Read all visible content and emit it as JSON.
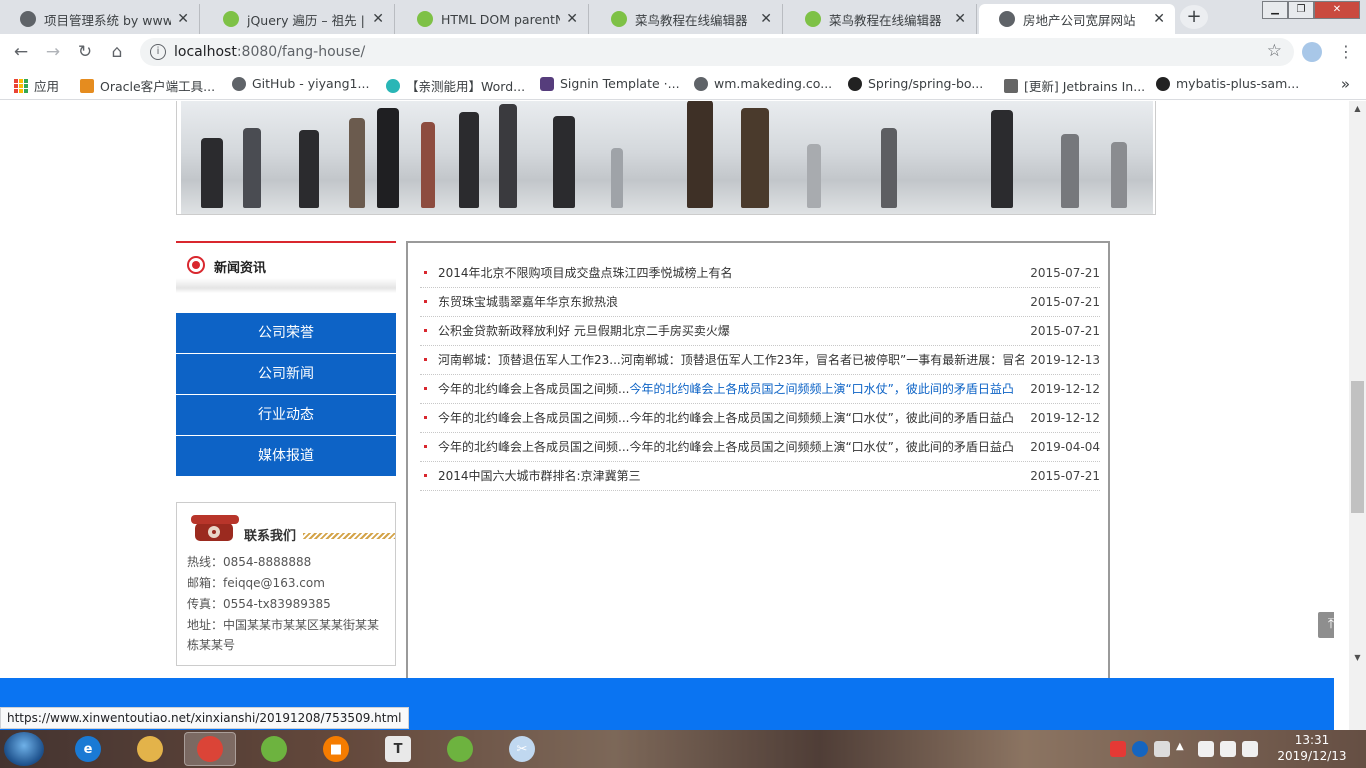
{
  "browser": {
    "tabs": [
      {
        "title": "项目管理系统 by www.n",
        "icon": "globe-icon",
        "active": false
      },
      {
        "title": "jQuery 遍历 – 祖先 | 菜鸟",
        "icon": "runoob-icon",
        "active": false
      },
      {
        "title": "HTML DOM parentNode",
        "icon": "runoob-icon",
        "active": false
      },
      {
        "title": "菜鸟教程在线编辑器",
        "icon": "runoob-icon",
        "active": false
      },
      {
        "title": "菜鸟教程在线编辑器",
        "icon": "runoob-icon",
        "active": false
      },
      {
        "title": "房地产公司宽屏网站",
        "icon": "globe-icon",
        "active": true
      }
    ],
    "address": {
      "host": "localhost",
      "rest": ":8080/fang-house/"
    },
    "bookmarks": [
      {
        "label": "应用",
        "icon": "apps-icon"
      },
      {
        "label": "Oracle客户端工具...",
        "icon": "oracle-icon"
      },
      {
        "label": "GitHub - yiyang1...",
        "icon": "globe-icon"
      },
      {
        "label": "【亲测能用】Word...",
        "icon": "bookmark-icon"
      },
      {
        "label": "Signin Template ·...",
        "icon": "bootstrap-icon"
      },
      {
        "label": "wm.makeding.co...",
        "icon": "globe-icon"
      },
      {
        "label": "Spring/spring-bo...",
        "icon": "github-icon"
      },
      {
        "label": "[更新] Jetbrains In...",
        "icon": "jetbrains-icon"
      },
      {
        "label": "mybatis-plus-sam...",
        "icon": "github-icon"
      }
    ],
    "status_url": "https://www.xinwentoutiao.net/xinxianshi/20191208/753509.html"
  },
  "sidebar": {
    "heading": "新闻资讯",
    "menu": [
      "公司荣誉",
      "公司新闻",
      "行业动态",
      "媒体报道"
    ],
    "contact": {
      "title": "联系我们",
      "hotline": "热线：0854-8888888",
      "email": "邮箱：feiqqe@163.com",
      "fax": "传真：0554-tx83989385",
      "address": "地址：中国某某市某某区某某街某某栋某某号"
    }
  },
  "news": [
    {
      "title": "2014年北京不限购项目成交盘点珠江四季悦城榜上有名",
      "highlight": "",
      "date": "2015-07-21"
    },
    {
      "title": "东贸珠宝城翡翠嘉年华京东掀热浪",
      "highlight": "",
      "date": "2015-07-21"
    },
    {
      "title": "公积金贷款新政释放利好 元旦假期北京二手房买卖火爆",
      "highlight": "",
      "date": "2015-07-21"
    },
    {
      "title": "河南郸城：顶替退伍军人工作23...河南郸城：顶替退伍军人工作23年，冒名者已被停职”一事有最新进展：冒名",
      "highlight": "",
      "date": "2019-12-13"
    },
    {
      "title": "今年的北约峰会上各成员国之间频...",
      "highlight": "今年的北约峰会上各成员国之间频频上演“口水仗”，彼此间的矛盾日益凸",
      "date": "2019-12-12"
    },
    {
      "title": "今年的北约峰会上各成员国之间频...今年的北约峰会上各成员国之间频频上演“口水仗”，彼此间的矛盾日益凸",
      "highlight": "",
      "date": "2019-12-12"
    },
    {
      "title": "今年的北约峰会上各成员国之间频...今年的北约峰会上各成员国之间频频上演“口水仗”，彼此间的矛盾日益凸",
      "highlight": "",
      "date": "2019-04-04"
    },
    {
      "title": "2014中国六大城市群排名:京津冀第三",
      "highlight": "",
      "date": "2015-07-21"
    }
  ],
  "taskbar": {
    "apps": [
      {
        "name": "ie-icon",
        "glyph": "e",
        "color": "#1a7ad4"
      },
      {
        "name": "explorer-icon",
        "glyph": "",
        "color": "#e3b34a"
      },
      {
        "name": "chrome-icon",
        "glyph": "",
        "color": "#db4437"
      },
      {
        "name": "spring-icon",
        "glyph": "",
        "color": "#6db33f"
      },
      {
        "name": "app-icon",
        "glyph": "■",
        "color": "#f57c00"
      },
      {
        "name": "typora-icon",
        "glyph": "T",
        "color": "#e9e9e9"
      },
      {
        "name": "spring-tool-icon",
        "glyph": "",
        "color": "#6db33f"
      },
      {
        "name": "snipping-tool-icon",
        "glyph": "✂",
        "color": "#c0d8f0"
      }
    ],
    "time": "13:31",
    "date": "2019/12/13"
  },
  "colors": {
    "accent_red": "#d9272e",
    "menu_blue": "#0d63c6",
    "footer_blue": "#0a74f2",
    "link_blue": "#0d63c6"
  }
}
